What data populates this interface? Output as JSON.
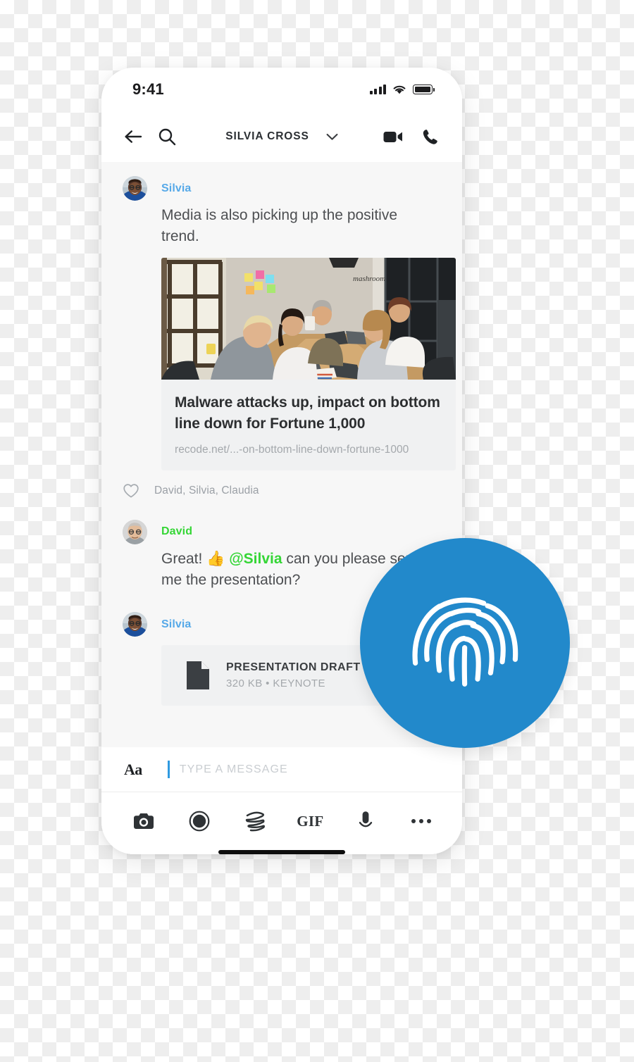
{
  "status_bar": {
    "time": "9:41",
    "signal_icon": "cellular-bars-icon",
    "wifi_icon": "wifi-icon",
    "battery_icon": "battery-icon"
  },
  "nav_bar": {
    "back_icon": "back-arrow-icon",
    "search_icon": "search-icon",
    "title": "SILVIA CROSS",
    "chevron_icon": "chevron-down-icon",
    "video_icon": "video-camera-icon",
    "call_icon": "phone-call-icon"
  },
  "conversation": {
    "messages": [
      {
        "sender": "Silvia",
        "sender_color": "#56a9e8",
        "avatar": "avatar-silvia",
        "text": "Media is also picking up the positive trend.",
        "link_preview": {
          "title": "Malware attacks up, impact on bottom line down for Fortune 1,000",
          "url": "recode.net/...-on-bottom-line-down-fortune-1000",
          "image": "office-meeting-photo"
        }
      },
      {
        "sender": "David",
        "sender_color": "#35d636",
        "avatar": "avatar-david",
        "text_parts": [
          {
            "text": "Great! ",
            "style": "plain"
          },
          {
            "text": "👍",
            "style": "emoji"
          },
          {
            "text": " ",
            "style": "plain"
          },
          {
            "text": "@Silvia",
            "style": "mention"
          },
          {
            "text": " can you please send me the presentation?",
            "style": "plain"
          }
        ]
      },
      {
        "sender": "Silvia",
        "sender_color": "#56a9e8",
        "avatar": "avatar-silvia",
        "attachment": {
          "icon": "document-file-icon",
          "name": "PRESENTATION DRAFT",
          "meta": "320 KB • KEYNOTE"
        }
      }
    ],
    "reactions": {
      "icon": "heart-outline-icon",
      "names": "David, Silvia, Claudia"
    }
  },
  "composer": {
    "format_icon": "text-format-aa-icon",
    "placeholder": "TYPE A MESSAGE",
    "value": "",
    "tools": [
      {
        "name": "camera-icon",
        "label": ""
      },
      {
        "name": "record-shutter-icon",
        "label": ""
      },
      {
        "name": "scribble-draw-icon",
        "label": ""
      },
      {
        "name": "gif-icon",
        "label": "GIF"
      },
      {
        "name": "microphone-icon",
        "label": ""
      },
      {
        "name": "more-options-icon",
        "label": ""
      }
    ]
  },
  "overlay": {
    "fingerprint_icon": "fingerprint-icon",
    "circle_color": "#2289cb",
    "stroke_color": "#ffffff"
  },
  "home_indicator": "home-indicator-bar"
}
